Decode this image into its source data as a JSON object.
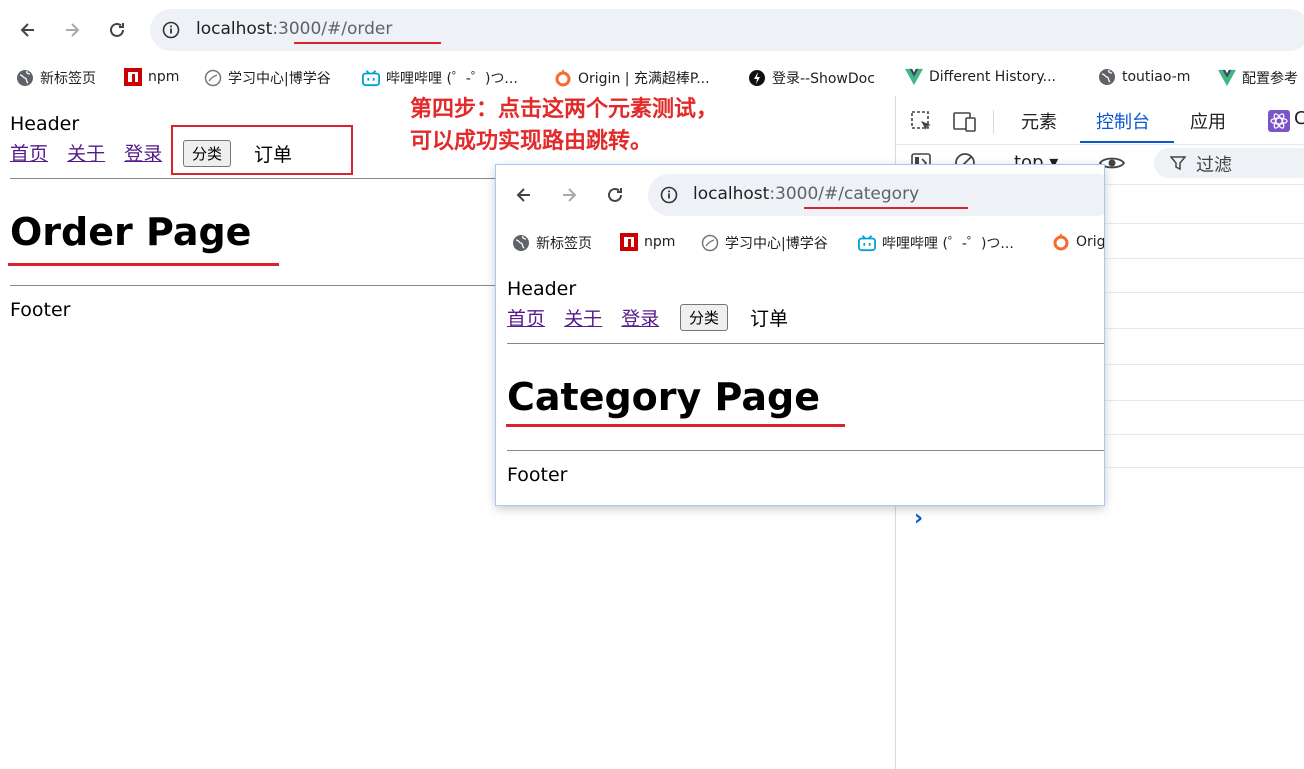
{
  "main_browser": {
    "url_host": "localhost",
    "url_rest": ":3000/#/order",
    "bookmarks": [
      {
        "label": "新标签页",
        "icon": "globe-icon"
      },
      {
        "label": "npm",
        "icon": "npm-icon"
      },
      {
        "label": "学习中心|博学谷",
        "icon": "globe-icon"
      },
      {
        "label": "哔哩哔哩 (゜-゜)つ...",
        "icon": "bilibili-icon"
      },
      {
        "label": "Origin | 充满超棒P...",
        "icon": "origin-icon"
      },
      {
        "label": "登录--ShowDoc",
        "icon": "showdoc-icon"
      },
      {
        "label": "Different History...",
        "icon": "vue-icon"
      },
      {
        "label": "toutiao-m",
        "icon": "globe-icon"
      },
      {
        "label": "配置参考",
        "icon": "vue-icon"
      }
    ],
    "page": {
      "header": "Header",
      "nav_links": [
        "首页",
        "关于",
        "登录"
      ],
      "button_label": "分类",
      "order_label": "订单",
      "title": "Order Page",
      "footer": "Footer"
    }
  },
  "annotation": {
    "line1": "第四步：点击这两个元素测试，",
    "line2": "可以成功实现路由跳转。",
    "color": "#e22a2a"
  },
  "devtools": {
    "tabs": [
      "元素",
      "控制台",
      "应用"
    ],
    "active_tab": "控制台",
    "context": "top",
    "filter_placeholder": "过滤",
    "prompt": "›"
  },
  "popup_browser": {
    "url_host": "localhost",
    "url_rest": ":3000/#/category",
    "bookmarks": [
      {
        "label": "新标签页",
        "icon": "globe-icon"
      },
      {
        "label": "npm",
        "icon": "npm-icon"
      },
      {
        "label": "学习中心|博学谷",
        "icon": "globe-icon"
      },
      {
        "label": "哔哩哔哩 (゜-゜)つ...",
        "icon": "bilibili-icon"
      },
      {
        "label": "Orig",
        "icon": "origin-icon"
      }
    ],
    "page": {
      "header": "Header",
      "nav_links": [
        "首页",
        "关于",
        "登录"
      ],
      "button_label": "分类",
      "order_label": "订单",
      "title": "Category Page",
      "footer": "Footer"
    }
  },
  "colors": {
    "accent_red": "#d9232e",
    "link_visited": "#551a8b",
    "devtools_active": "#0b57d0"
  }
}
